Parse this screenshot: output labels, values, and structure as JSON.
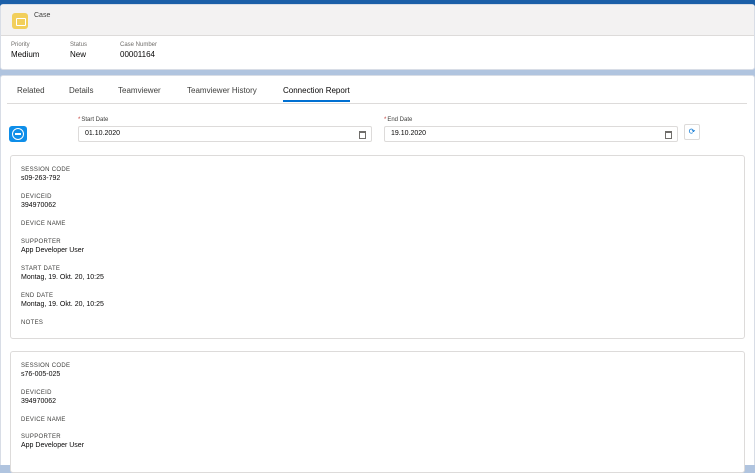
{
  "header": {
    "object": "Case",
    "fields": [
      {
        "label": "Priority",
        "value": "Medium"
      },
      {
        "label": "Status",
        "value": "New"
      },
      {
        "label": "Case Number",
        "value": "00001164"
      }
    ]
  },
  "tabs": [
    "Related",
    "Details",
    "Teamviewer",
    "Teamviewer History",
    "Connection Report"
  ],
  "active_tab": "Connection Report",
  "filters": {
    "required_marker": "*",
    "start_label": "Start Date",
    "start_value": "01.10.2020",
    "end_label": "End Date",
    "end_value": "19.10.2020",
    "refresh_icon": "refresh-icon"
  },
  "reports": [
    {
      "rows": [
        {
          "label": "SESSION CODE",
          "value": "s09-263-792"
        },
        {
          "label": "DEVICEID",
          "value": "394970062"
        },
        {
          "label": "DEVICE NAME",
          "value": ""
        },
        {
          "label": "SUPPORTER",
          "value": "App Developer User"
        },
        {
          "label": "START DATE",
          "value": "Montag, 19. Okt. 20, 10:25"
        },
        {
          "label": "END DATE",
          "value": "Montag, 19. Okt. 20, 10:25"
        },
        {
          "label": "NOTES",
          "value": ""
        }
      ]
    },
    {
      "rows": [
        {
          "label": "SESSION CODE",
          "value": "s76-005-025"
        },
        {
          "label": "DEVICEID",
          "value": "394970062"
        },
        {
          "label": "DEVICE NAME",
          "value": ""
        },
        {
          "label": "SUPPORTER",
          "value": "App Developer User"
        }
      ]
    }
  ],
  "colors": {
    "accent": "#0070d2",
    "case_icon": "#f2cf5b",
    "teamviewer": "#0e8ee9"
  }
}
